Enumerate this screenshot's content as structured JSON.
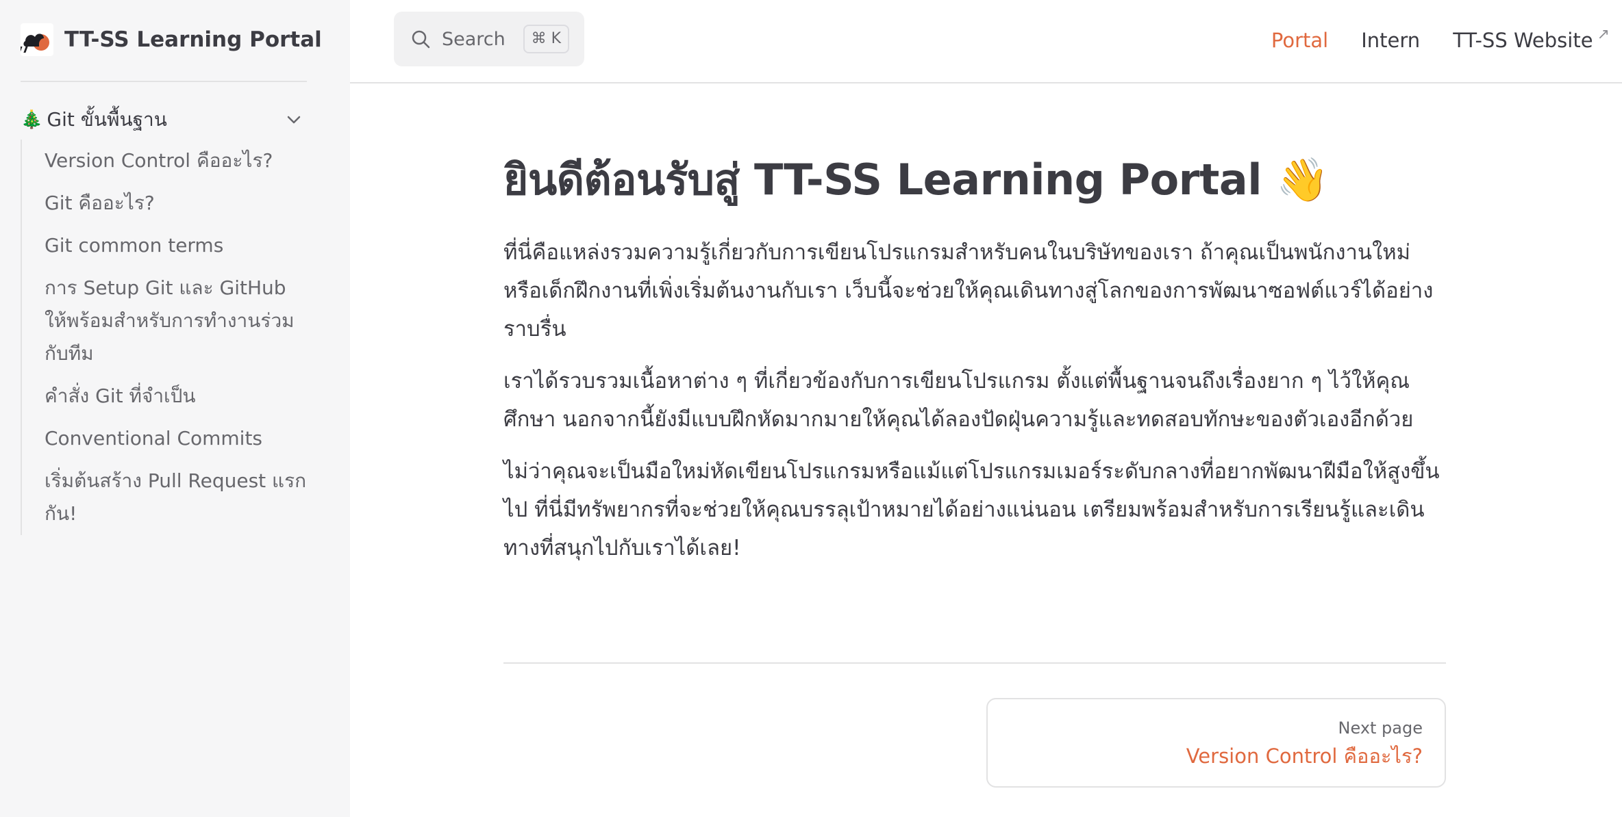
{
  "brand": {
    "title": "TT-SS Learning Portal"
  },
  "sidebar": {
    "group": {
      "icon": "🎄",
      "title": "Git ขั้นพื้นฐาน",
      "items": [
        {
          "label": "Version Control คืออะไร?"
        },
        {
          "label": "Git คืออะไร?"
        },
        {
          "label": "Git common terms"
        },
        {
          "label": "การ Setup Git และ GitHub ให้พร้อมสำหรับการทำงานร่วมกับทีม"
        },
        {
          "label": "คำสั่ง Git ที่จำเป็น"
        },
        {
          "label": "Conventional Commits"
        },
        {
          "label": "เริ่มต้นสร้าง Pull Request แรกกัน!"
        }
      ]
    }
  },
  "search": {
    "label": "Search",
    "shortcut": "⌘ K"
  },
  "topnav": {
    "portal": "Portal",
    "intern": "Intern",
    "website": "TT-SS Website",
    "external_glyph": "↗"
  },
  "main": {
    "title": "ยินดีต้อนรับสู่ TT-SS Learning Portal 👋",
    "paragraphs": [
      "ที่นี่คือแหล่งรวมความรู้เกี่ยวกับการเขียนโปรแกรมสำหรับคนในบริษัทของเรา ถ้าคุณเป็นพนักงานใหม่หรือเด็กฝึกงานที่เพิ่งเริ่มต้นงานกับเรา เว็บนี้จะช่วยให้คุณเดินทางสู่โลกของการพัฒนาซอฟต์แวร์ได้อย่างราบรื่น",
      "เราได้รวบรวมเนื้อหาต่าง ๆ ที่เกี่ยวข้องกับการเขียนโปรแกรม ตั้งแต่พื้นฐานจนถึงเรื่องยาก ๆ ไว้ให้คุณศึกษา นอกจากนี้ยังมีแบบฝึกหัดมากมายให้คุณได้ลองปัดฝุ่นความรู้และทดสอบทักษะของตัวเองอีกด้วย",
      "ไม่ว่าคุณจะเป็นมือใหม่หัดเขียนโปรแกรมหรือแม้แต่โปรแกรมเมอร์ระดับกลางที่อยากพัฒนาฝีมือให้สูงขึ้นไป ที่นี่มีทรัพยากรที่จะช่วยให้คุณบรรลุเป้าหมายได้อย่างแน่นอน เตรียมพร้อมสำหรับการเรียนรู้และเดินทางที่สนุกไปกับเราได้เลย!"
    ]
  },
  "pager": {
    "label": "Next page",
    "title": "Version Control คืออะไร?"
  },
  "colors": {
    "accent": "#e0693f",
    "sidebar_bg": "#f6f6f7",
    "text": "#3c3c43",
    "muted": "#67676c"
  },
  "icons": {
    "logo": "cloud-logo-icon",
    "search": "search-icon",
    "chevron": "chevron-down-icon",
    "external": "external-link-icon",
    "tree": "christmas-tree-icon"
  }
}
